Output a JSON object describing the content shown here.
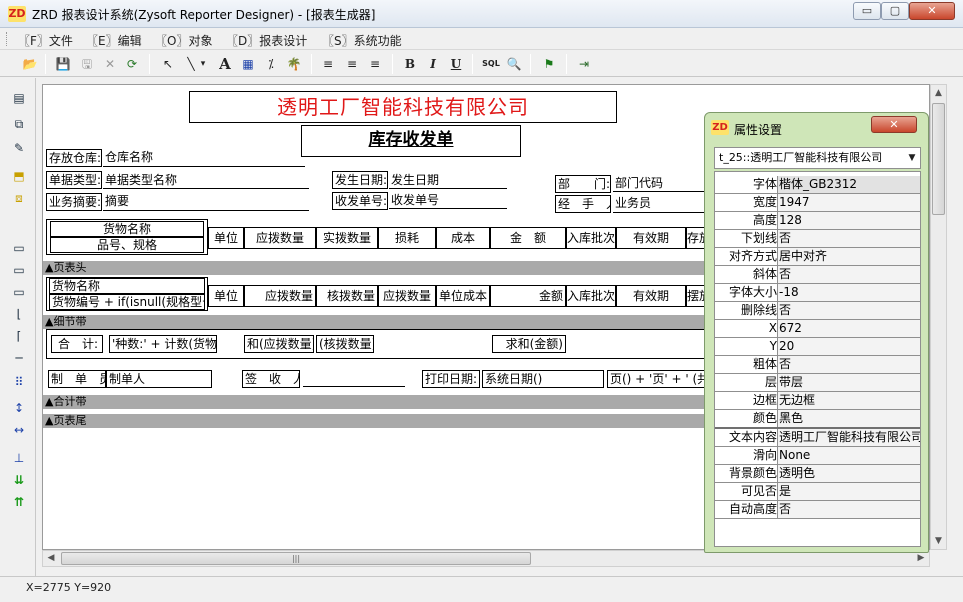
{
  "window": {
    "logo_text": "ZD",
    "title": "ZRD 报表设计系统(Zysoft  Reporter  Designer) - [报表生成器]",
    "min_label": "▭",
    "max_label": "▢",
    "close_label": "✕"
  },
  "menu": {
    "items": [
      {
        "label": "〖F〗文件"
      },
      {
        "label": "〖E〗编辑"
      },
      {
        "label": "〖O〗对象"
      },
      {
        "label": "〖D〗报表设计"
      },
      {
        "label": "〖S〗系统功能"
      }
    ]
  },
  "toolbar": {
    "open": "📂",
    "save": "💾",
    "save_gray": "🖫",
    "delete": "✕",
    "refresh": "⟳",
    "pointer": "↖",
    "line": "╲",
    "dropdown": "▾",
    "text": "A",
    "grid": "▦",
    "percent": "⁒",
    "tree": "🌴",
    "align_left": "≡",
    "align_center": "≡",
    "align_right": "≡",
    "bold": "B",
    "italic": "I",
    "underline": "U",
    "sql": "SQL",
    "preview": "🔍",
    "flag": "⚑",
    "exit": "⇥"
  },
  "tools": {
    "t1": "▤",
    "t2": "⧉",
    "t3": "✎",
    "t4": "⬒",
    "t5": "⧈",
    "t6": "▭",
    "t7": "▭",
    "t8": "▭",
    "t9": "⌊",
    "t10": "⌈",
    "t11": "─",
    "t12": "⠿",
    "t13": "↕",
    "t14": "↔",
    "t15": "⊥",
    "t16": "⇊",
    "t17": "⇈"
  },
  "report": {
    "company": "透明工厂智能科技有限公司",
    "doc_title": "库存收发单",
    "warehouse_label": "存放仓库:",
    "warehouse_value": "仓库名称",
    "doctype_label": "单据类型:",
    "doctype_value": "单据类型名称",
    "date_label": "发生日期:",
    "date_value": "发生日期",
    "dept_label": "部　　门:",
    "dept_value": "部门代码",
    "summary_label": "业务摘要:",
    "summary_value": "摘要",
    "docno_label": "收发单号:",
    "docno_value": "收发单号",
    "handler_label": "经　手　人:",
    "handler_value": "业务员",
    "header_cells": {
      "goods_name": "货物名称",
      "spec": "品号、规格",
      "unit": "单位",
      "due_qty": "应拨数量",
      "actual_qty": "实拨数量",
      "loss": "损耗",
      "cost": "成本",
      "amount": "金　额",
      "in_batch": "入库批次",
      "valid": "有效期",
      "place": "存放"
    },
    "band_page_header": "▲页表头",
    "detail_cells": {
      "goods_name": "货物名称",
      "goods_code": "货物编号 + if(isnull(规格型号",
      "unit": "单位",
      "due_qty": "应拨数量",
      "check_qty": "核拨数量",
      "due_qty2": "应拨数量",
      "unit_cost": "单位成本",
      "amount": "金额",
      "in_batch": "入库批次",
      "valid": "有效期",
      "place": "摆放"
    },
    "band_detail": "▲细节带",
    "total_label": "合　计:",
    "total_count": "'种数:' + 计数(货物编",
    "total_due": "和(应拨数量)",
    "total_check": "(核拨数量)",
    "total_amount": "求和(金额)",
    "maker_label": "制　单　员:",
    "maker_value": "制单人",
    "sign_label": "签　收　人:",
    "print_label": "打印日期:",
    "print_value": "系统日期()",
    "page_value": "页() + '页' + ' (共 '",
    "band_total": "▲合计带",
    "band_footer": "▲页表尾"
  },
  "status": {
    "coords": "X=2775   Y=920"
  },
  "scroll": {
    "up": "▲",
    "down": "▼",
    "left": "◀",
    "right": "▶",
    "grip": "|||",
    "vgrip": "≡"
  },
  "properties": {
    "title": "属性设置",
    "close_label": "✕",
    "selected_object": "t_25::透明工厂智能科技有限公司",
    "dropdown": "▼",
    "rows": [
      {
        "key": "字体",
        "value": "楷体_GB2312"
      },
      {
        "key": "宽度",
        "value": "1947"
      },
      {
        "key": "高度",
        "value": "128"
      },
      {
        "key": "下划线",
        "value": "否"
      },
      {
        "key": "对齐方式",
        "value": "居中对齐"
      },
      {
        "key": "斜体",
        "value": "否"
      },
      {
        "key": "字体大小",
        "value": "-18"
      },
      {
        "key": "删除线",
        "value": "否"
      },
      {
        "key": "X",
        "value": "672"
      },
      {
        "key": "Y",
        "value": "20"
      },
      {
        "key": "粗体",
        "value": "否"
      },
      {
        "key": "层",
        "value": "带层"
      },
      {
        "key": "边框",
        "value": "无边框"
      },
      {
        "key": "颜色",
        "value": "黑色"
      },
      {
        "key": "文本内容",
        "value": "透明工厂智能科技有限公司"
      },
      {
        "key": "滑向",
        "value": "None"
      },
      {
        "key": "背景颜色",
        "value": "透明色"
      },
      {
        "key": "可见否",
        "value": "是"
      },
      {
        "key": "自动高度",
        "value": "否"
      }
    ]
  }
}
